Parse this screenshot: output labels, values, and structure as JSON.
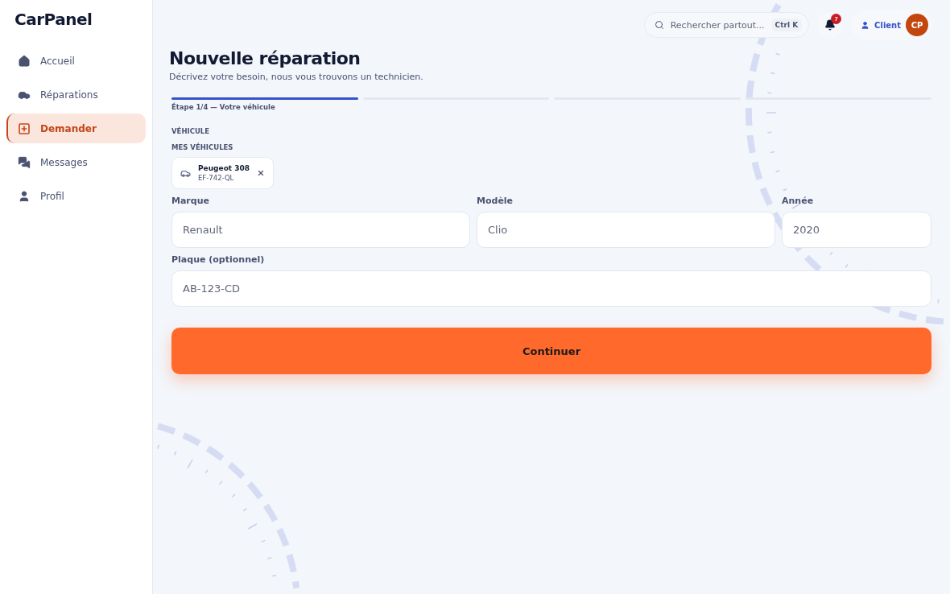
{
  "logo": {
    "text": "CarPanel"
  },
  "sidebar": {
    "items": [
      {
        "label": "Accueil",
        "selected": false
      },
      {
        "label": "Réparations",
        "selected": false
      },
      {
        "label": "Demander",
        "selected": true
      },
      {
        "label": "Messages",
        "selected": false
      },
      {
        "label": "Profil",
        "selected": false
      }
    ]
  },
  "topbar": {
    "search": {
      "placeholder": "Rechercher partout...",
      "shortcut": "Ctrl K"
    },
    "notifications": {
      "count": "7"
    },
    "user": {
      "role": "Client",
      "initials": "CP"
    }
  },
  "page": {
    "title": "Nouvelle réparation",
    "subtitle": "Décrivez votre besoin, nous vous trouvons un technicien."
  },
  "steps": [
    {
      "selected": true,
      "label": "Étape 1/4 — Votre véhicule"
    },
    {
      "selected": false
    },
    {
      "selected": false
    },
    {
      "selected": false
    }
  ],
  "section": "VÉHICULE",
  "vehicles": {
    "label": "MES VÉHICULES",
    "items": [
      {
        "name": "Peugeot 308",
        "plate": "EF-742-QL"
      }
    ]
  },
  "fields": [
    {
      "label": "Marque",
      "placeholder": "Renault"
    },
    {
      "label": "Modèle",
      "placeholder": "Clio"
    },
    {
      "label": "Année",
      "placeholder": "2020"
    },
    {
      "label": "Plaque (optionnel)",
      "placeholder": "AB-123-CD"
    }
  ],
  "submit": "Continuer"
}
